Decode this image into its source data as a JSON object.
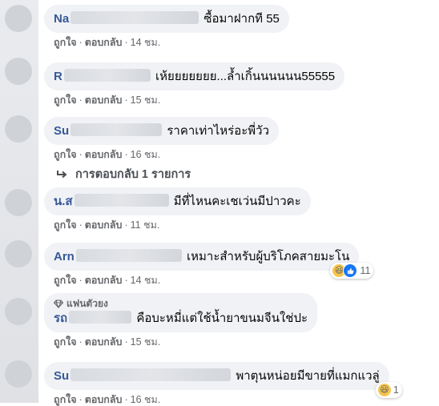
{
  "comments": [
    {
      "name": "Na",
      "text": "ซื้อมาฝากที 55",
      "like": "ถูกใจ",
      "reply": "ตอบกลับ",
      "time": "14 ชม."
    },
    {
      "name": "R",
      "text": "เห้ยยยยยยย...ล้ำเกิ้นนนนนน55555",
      "like": "ถูกใจ",
      "reply": "ตอบกลับ",
      "time": "15 ชม."
    },
    {
      "name": "Su",
      "text": "ราคาเท่าไหร่อะพี่วัว",
      "like": "ถูกใจ",
      "reply": "ตอบกลับ",
      "time": "16 ชม."
    },
    {
      "name": "น.ส",
      "text": "มีที่ไหนคะเชเว่นมีปาวคะ",
      "like": "ถูกใจ",
      "reply": "ตอบกลับ",
      "time": "11 ชม."
    },
    {
      "name": "Arn",
      "text": "เหมาะสำหรับผู้บริโภคสายมะโน",
      "like": "ถูกใจ",
      "reply": "ตอบกลับ",
      "time": "14 ชม.",
      "reaction_count": "11"
    },
    {
      "badge": "แฟนตัวยง",
      "name": "รถ",
      "text": "คือบะหมี่แต่ใช้น้ำยาขนมจีนใช่ปะ",
      "like": "ถูกใจ",
      "reply": "ตอบกลับ",
      "time": "15 ชม."
    },
    {
      "name": "Su",
      "text": "พาตุนหน่อยมีขายที่แมกแวลู่",
      "like": "ถูกใจ",
      "reply": "ตอบกลับ",
      "time": "16 ชม.",
      "reaction_count": "1"
    }
  ],
  "replies_link": "การตอบกลับ 1 รายการ",
  "separator": "·",
  "colors": {
    "bubble": "#f0f2f5",
    "name": "#385898",
    "meta": "#65676b",
    "like_blue": "#1877f2",
    "haha_yellow": "#f7c54a"
  }
}
